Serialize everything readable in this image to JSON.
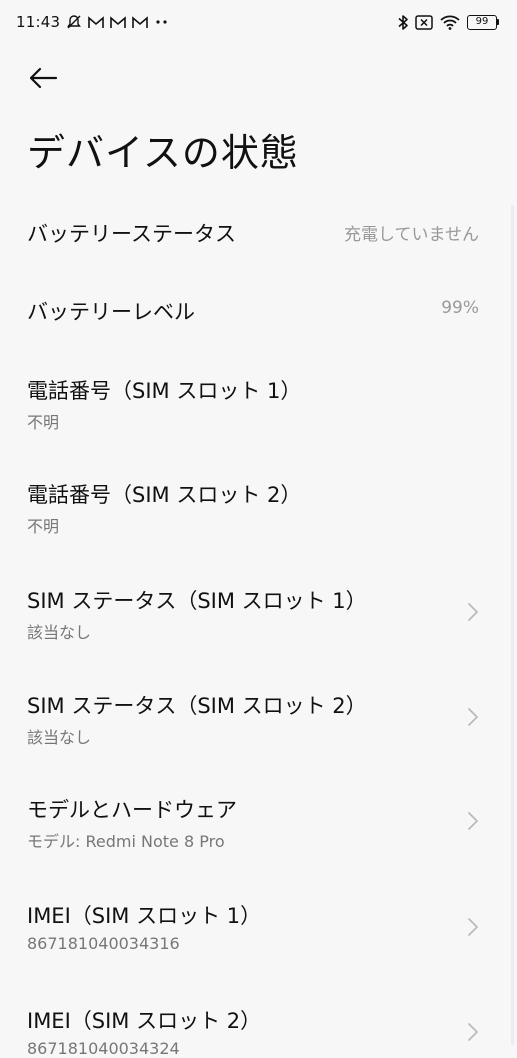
{
  "status_bar": {
    "time": "11:43",
    "battery_level": "99",
    "icons": [
      "alarm-off-icon",
      "gmail-icon",
      "gmail-icon",
      "gmail-icon",
      "more-dots-icon",
      "bluetooth-icon",
      "sim-off-icon",
      "wifi-icon",
      "battery-icon"
    ]
  },
  "header": {
    "title": "デバイスの状態"
  },
  "rows": [
    {
      "title": "バッテリーステータス",
      "value": "充電していません"
    },
    {
      "title": "バッテリーレベル",
      "value": "99%"
    },
    {
      "title": "電話番号（SIM スロット 1）",
      "sub": "不明"
    },
    {
      "title": "電話番号（SIM スロット 2）",
      "sub": "不明"
    },
    {
      "title": "SIM ステータス（SIM スロット 1）",
      "sub": "該当なし"
    },
    {
      "title": "SIM ステータス（SIM スロット 2）",
      "sub": "該当なし"
    },
    {
      "title": "モデルとハードウェア",
      "sub": "モデル: Redmi Note 8 Pro"
    },
    {
      "title": "IMEI（SIM スロット 1）",
      "sub": "867181040034316"
    },
    {
      "title": "IMEI（SIM スロット 2）",
      "sub": "867181040034324"
    }
  ],
  "colors": {
    "background": "#f7f7f7",
    "text": "#111111",
    "secondary": "#777777",
    "value": "#999999"
  }
}
